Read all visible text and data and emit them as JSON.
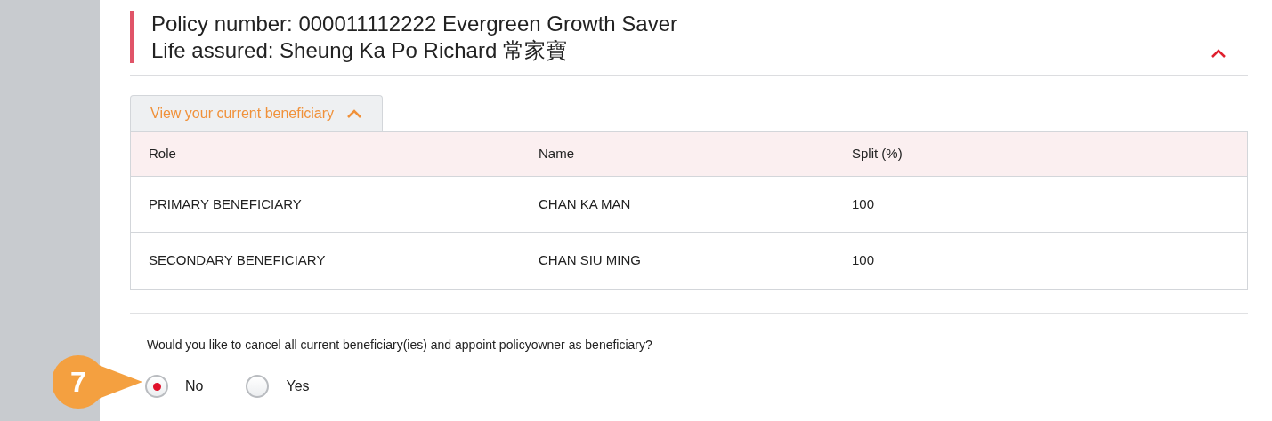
{
  "policy_header": {
    "line_1": "Policy number: 000011112222 Evergreen Growth Saver",
    "line_2": "Life assured: Sheung Ka Po Richard 常家寶",
    "expanded": true
  },
  "beneficiary_tab": {
    "label": "View your current beneficiary",
    "expanded": true
  },
  "table": {
    "columns": [
      "Role",
      "Name",
      "Split (%)"
    ],
    "rows": [
      [
        "PRIMARY BENEFICIARY",
        "CHAN KA MAN",
        "100"
      ],
      [
        "SECONDARY BENEFICIARY",
        "CHAN SIU MING",
        "100"
      ]
    ]
  },
  "question": "Would you like to cancel all current beneficiary(ies) and appoint policyowner as beneficiary?",
  "options": [
    {
      "label": "No",
      "selected": true
    },
    {
      "label": "Yes",
      "selected": false
    }
  ],
  "callout": {
    "label": "7"
  }
}
